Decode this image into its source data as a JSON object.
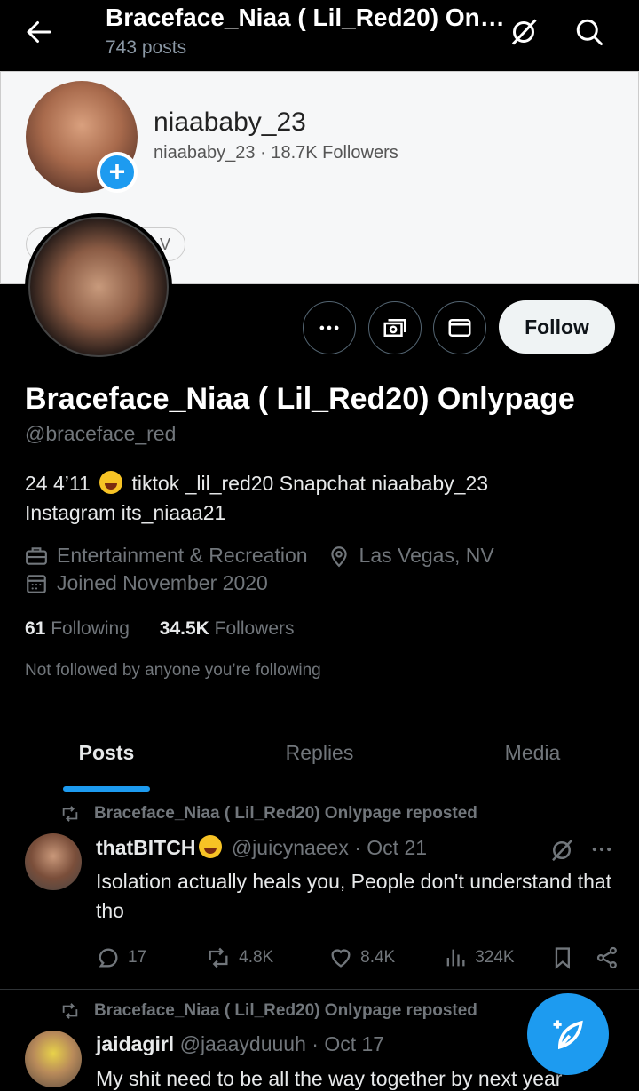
{
  "header": {
    "title": "Braceface_Niaa ( Lil_Red20) Onl...",
    "post_count": "743 posts"
  },
  "banner": {
    "name": "niaababy_23",
    "subtitle": "niaababy_23 · 18.7K Followers",
    "pill_text": "V"
  },
  "profile": {
    "display_name": "Braceface_Niaa ( Lil_Red20) Onlypage",
    "handle": "@braceface_red",
    "bio_part1": "24 4’11 ",
    "bio_part2": " tiktok _lil_red20  Snapchat  niaababy_23",
    "bio_line2": "Instagram its_niaaa21",
    "category": "Entertainment & Recreation",
    "location": "Las Vegas, NV",
    "joined": "Joined November 2020",
    "following_count": "61",
    "following_label": "Following",
    "followers_count": "34.5K",
    "followers_label": "Followers",
    "not_followed": "Not followed by anyone you’re following",
    "follow_label": "Follow"
  },
  "tabs": [
    {
      "label": "Posts",
      "active": true
    },
    {
      "label": "Replies",
      "active": false
    },
    {
      "label": "Media",
      "active": false
    }
  ],
  "posts": [
    {
      "repost_text": "Braceface_Niaa ( Lil_Red20) Onlypage reposted",
      "name": "thatBITCH",
      "handle_date": "@juicynaeex · Oct 21",
      "text": "Isolation actually heals you, People don't understand that tho",
      "replies": "17",
      "reposts": "4.8K",
      "likes": "8.4K",
      "views": "324K"
    },
    {
      "repost_text": "Braceface_Niaa ( Lil_Red20) Onlypage reposted",
      "name": "jaidagirl",
      "handle_date": "@jaaayduuuh · Oct 17",
      "text": "My shit need to be all the way together by next year"
    }
  ],
  "colors": {
    "accent": "#1d9bf0",
    "muted": "#71767b",
    "text": "#e7e9ea",
    "background": "#000000"
  }
}
